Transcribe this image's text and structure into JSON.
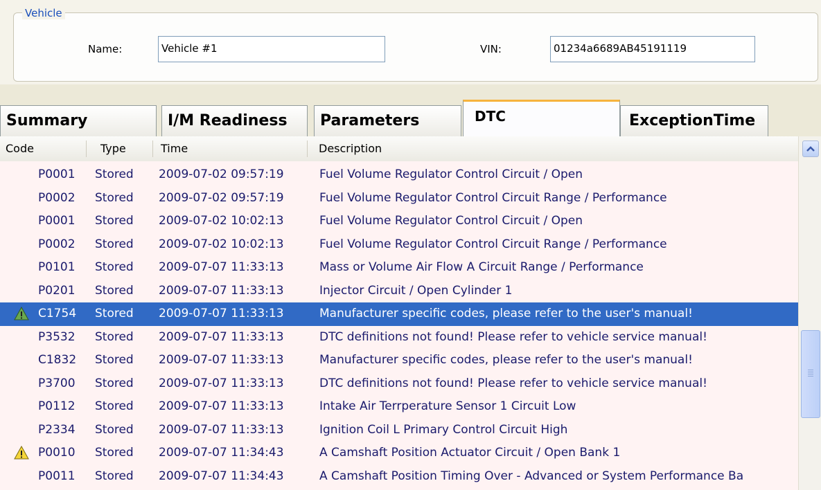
{
  "vehicle": {
    "legend": "Vehicle",
    "name_label": "Name:",
    "name_value": "Vehicle #1",
    "vin_label": "VIN:",
    "vin_value": "01234a6689AB45191119"
  },
  "tabs": [
    {
      "label": "Summary"
    },
    {
      "label": "I/M Readiness"
    },
    {
      "label": "Parameters"
    },
    {
      "label": "DTC",
      "active": true
    },
    {
      "label": "ExceptionTime"
    }
  ],
  "columns": [
    "Code",
    "Type",
    "Time",
    "Description"
  ],
  "rows": [
    {
      "code": "P0001",
      "type": "Stored",
      "time": "2009-07-02 09:57:19",
      "description": "Fuel Volume Regulator Control Circuit / Open",
      "icon": ""
    },
    {
      "code": "P0002",
      "type": "Stored",
      "time": "2009-07-02 09:57:19",
      "description": "Fuel Volume Regulator Control Circuit Range / Performance",
      "icon": ""
    },
    {
      "code": "P0001",
      "type": "Stored",
      "time": "2009-07-02 10:02:13",
      "description": "Fuel Volume Regulator Control Circuit / Open",
      "icon": ""
    },
    {
      "code": "P0002",
      "type": "Stored",
      "time": "2009-07-02 10:02:13",
      "description": "Fuel Volume Regulator Control Circuit Range / Performance",
      "icon": ""
    },
    {
      "code": "P0101",
      "type": "Stored",
      "time": "2009-07-07 11:33:13",
      "description": "Mass or Volume Air Flow A Circuit Range / Performance",
      "icon": ""
    },
    {
      "code": "P0201",
      "type": "Stored",
      "time": "2009-07-07 11:33:13",
      "description": "Injector Circuit / Open Cylinder 1",
      "icon": ""
    },
    {
      "code": "C1754",
      "type": "Stored",
      "time": "2009-07-07 11:33:13",
      "description": "Manufacturer specific codes, please refer to the user's manual!",
      "icon": "warning-icon",
      "selected": true
    },
    {
      "code": "P3532",
      "type": "Stored",
      "time": "2009-07-07 11:33:13",
      "description": "DTC definitions not found! Please refer to vehicle service manual!",
      "icon": ""
    },
    {
      "code": "C1832",
      "type": "Stored",
      "time": "2009-07-07 11:33:13",
      "description": "Manufacturer specific codes, please refer to the user's manual!",
      "icon": ""
    },
    {
      "code": "P3700",
      "type": "Stored",
      "time": "2009-07-07 11:33:13",
      "description": "DTC definitions not found! Please refer to vehicle service manual!",
      "icon": ""
    },
    {
      "code": "P0112",
      "type": "Stored",
      "time": "2009-07-07 11:33:13",
      "description": "Intake Air Terrperature Sensor 1 Circuit Low",
      "icon": ""
    },
    {
      "code": "P2334",
      "type": "Stored",
      "time": "2009-07-07 11:33:13",
      "description": "Ignition Coil L Primary Control Circuit High",
      "icon": ""
    },
    {
      "code": "P0010",
      "type": "Stored",
      "time": "2009-07-07 11:34:43",
      "description": "A Camshaft Position Actuator Circuit / Open Bank 1",
      "icon": "warning-icon"
    },
    {
      "code": "P0011",
      "type": "Stored",
      "time": "2009-07-07 11:34:43",
      "description": "A Camshaft Position Timing Over - Advanced or System Performance Ba",
      "icon": ""
    }
  ],
  "colors": {
    "selection": "#316ac5",
    "row_background": "#fff3f3",
    "active_tab_accent": "#f7b33d",
    "legend_text": "#1a4fbb"
  }
}
